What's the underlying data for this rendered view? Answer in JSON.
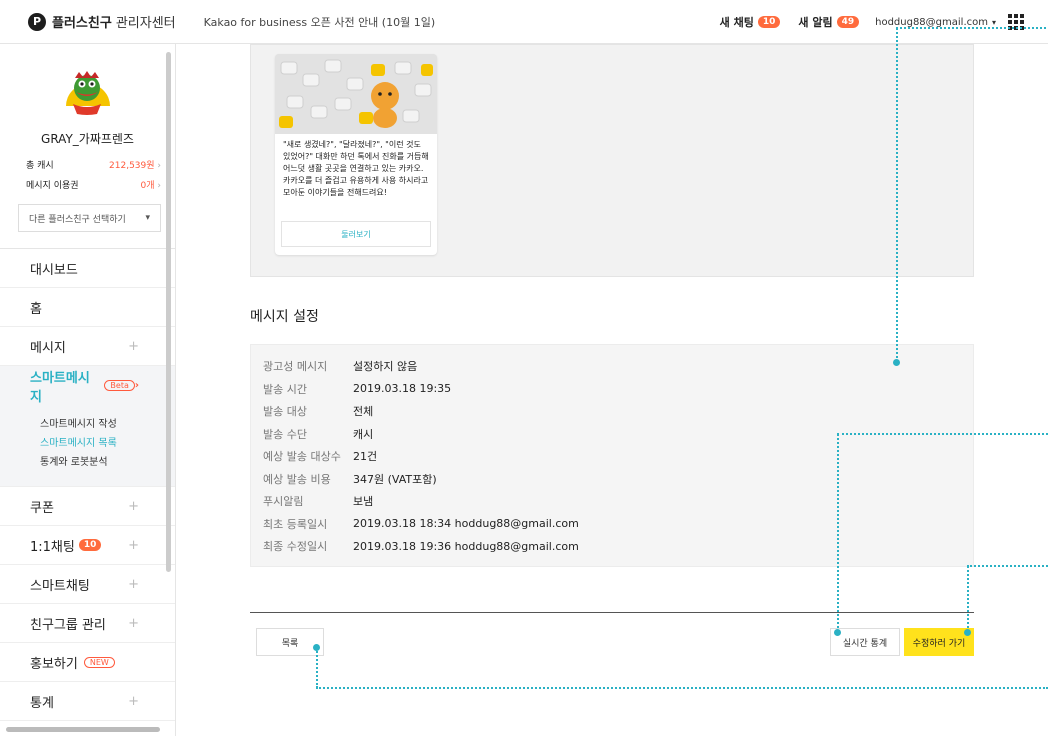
{
  "topbar": {
    "brand": "플러스친구",
    "brand_sub": "관리자센터",
    "notice": "Kakao for business 오픈 사전 안내 (10월 1일)",
    "chat_label": "새 채팅",
    "chat_count": "10",
    "alert_label": "새 알림",
    "alert_count": "49",
    "email": "hoddug88@gmail.com",
    "caret": "▾"
  },
  "sidebar": {
    "profile_name": "GRAY_가짜프렌즈",
    "cash_label": "총 캐시",
    "cash_value": "212,539원",
    "voucher_label": "메시지 이용권",
    "voucher_value": "0개",
    "select_placeholder": "다른 플러스친구 선택하기",
    "select_caret": "▾",
    "items": [
      {
        "label": "대시보드"
      },
      {
        "label": "홈"
      },
      {
        "label": "메시지",
        "plus": "+"
      },
      {
        "label": "스마트메시지",
        "badge": "Beta",
        "chevron": "›"
      },
      {
        "label": "쿠폰",
        "plus": "+"
      },
      {
        "label": "1:1채팅",
        "badge": "10",
        "plus": "+"
      },
      {
        "label": "스마트채팅",
        "plus": "+"
      },
      {
        "label": "친구그룹 관리",
        "plus": "+"
      },
      {
        "label": "홍보하기",
        "badge": "NEW"
      },
      {
        "label": "통계",
        "plus": "+"
      }
    ],
    "sub_items": [
      {
        "label": "스마트메시지 작성"
      },
      {
        "label": "스마트메시지 목록"
      },
      {
        "label": "통계와 로봇분석"
      }
    ]
  },
  "preview": {
    "card_text": "\"새로 생겼네?\", \"달라졌네?\", \"이런 것도 있었어?\" 대화만 하던 톡에서 진화를 거듭해 어느덧 생활 곳곳을 연결하고 있는 카카오. 카카오를 더 즐겁고 유용하게 사용 하시라고 모아둔 이야기들을 전해드려요!",
    "card_button": "둘러보기"
  },
  "settings": {
    "title": "메시지 설정",
    "rows": [
      {
        "key": "광고성 메시지",
        "value": "설정하지 않음"
      },
      {
        "key": "발송 시간",
        "value": "2019.03.18 19:35"
      },
      {
        "key": "발송 대상",
        "value": "전체"
      },
      {
        "key": "발송 수단",
        "value": "캐시"
      },
      {
        "key": "예상 발송 대상수",
        "value": "21건"
      },
      {
        "key": "예상 발송 비용",
        "value": "347원 (VAT포함)"
      },
      {
        "key": "푸시알림",
        "value": "보냄"
      },
      {
        "key": "최초 등록일시",
        "value": "2019.03.18 18:34  hoddug88@gmail.com"
      },
      {
        "key": "최종 수정일시",
        "value": "2019.03.18 19:36  hoddug88@gmail.com"
      }
    ]
  },
  "actions": {
    "list": "목록",
    "stats": "실시간 통계",
    "edit": "수정하러 가기"
  },
  "colors": {
    "accent": "#2ab1c4",
    "badge": "#ff6b3d",
    "primary_button": "#ffe21c"
  }
}
